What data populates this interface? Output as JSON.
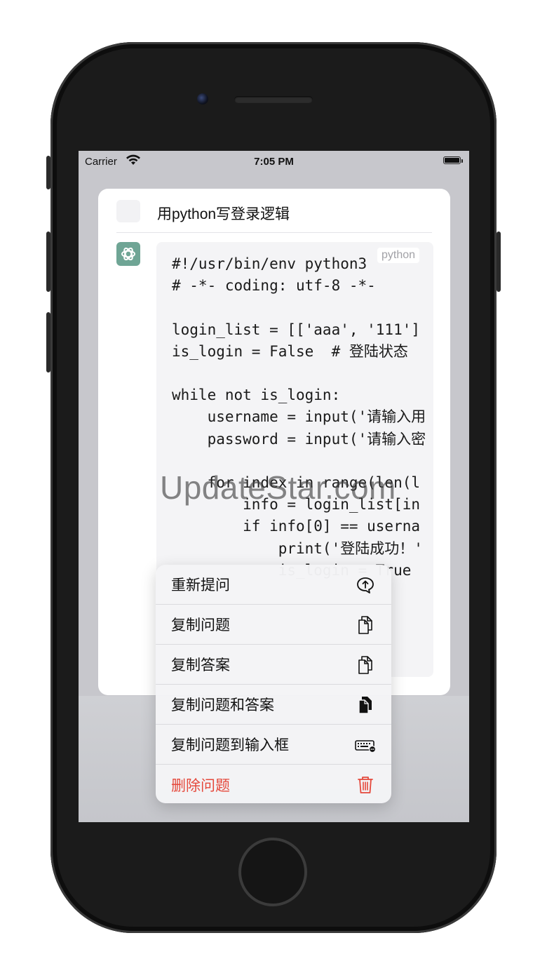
{
  "status": {
    "carrier": "Carrier",
    "time": "7:05 PM"
  },
  "question": {
    "text": "用python写登录逻辑"
  },
  "answer": {
    "language": "python",
    "code": "#!/usr/bin/env python3\n# -*- coding: utf-8 -*-\n\nlogin_list = [['aaa', '111']\nis_login = False  # 登陆状态\n\nwhile not is_login:\n    username = input('请输入用\n    password = input('请输入密\n\n    for index in range(len(l\n        info = login_list[in\n        if info[0] == userna\n            print('登陆成功！'\n            is_login = True"
  },
  "menu": {
    "items": [
      {
        "label": "重新提问",
        "icon": "ask-again-icon"
      },
      {
        "label": "复制问题",
        "icon": "copy-icon"
      },
      {
        "label": "复制答案",
        "icon": "copy-icon"
      },
      {
        "label": "复制问题和答案",
        "icon": "copy-filled-icon"
      },
      {
        "label": "复制问题到输入框",
        "icon": "keyboard-icon"
      },
      {
        "label": "删除问题",
        "icon": "trash-icon",
        "color": "#e5483b"
      }
    ]
  },
  "watermark": "UpdateStar.com"
}
